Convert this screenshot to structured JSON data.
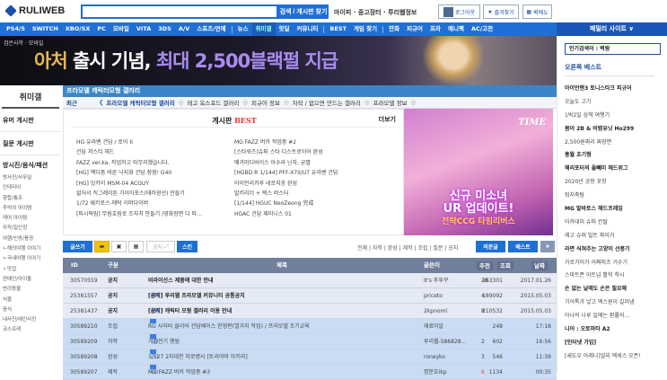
{
  "header": {
    "logo": "RULIWEB",
    "search_placeholder": "",
    "search_button": "검색 / 게시판 찾기",
    "links": "마이피 · 중고장터 · 루리웹정보",
    "logout": "로그아웃",
    "favorites": "즐겨찾기",
    "menu": "퀵메뉴"
  },
  "nav": {
    "items": [
      "PS4/5",
      "SWITCH",
      "XBO/SX",
      "PC",
      "모바일",
      "VITA",
      "3DS",
      "A/V",
      "스포츠/연예",
      "뉴스",
      "취미갤",
      "핫딜",
      "커뮤니티",
      "BEST",
      "게임 찾기",
      "만화",
      "피규어",
      "프라",
      "애니팩",
      "AC/고전"
    ],
    "active": "취미갤",
    "family": "패밀리 사이트 ∨"
  },
  "banner": {
    "brand": "검은사막 · 모바일",
    "headline_a": "아처",
    "headline_b": " 출시 기념, ",
    "headline_c": "최대 2,500블랙펄 지급"
  },
  "sidebar": {
    "title": "취미갤",
    "boards": [
      "유머 게시판",
      "질문 게시판"
    ],
    "category": "방시진/음식/패션",
    "items": [
      "방사진/사무실",
      "인테리어",
      "향합/통조",
      "추억의 아이템",
      "레어 아이템",
      "자작/일인칭",
      "여행/인증/풍경",
      "ㄴ해외여행 이야기",
      "ㄴ국내여행 이야기",
      "ㄴ맛집",
      "연예인/아이돌",
      "반려동물",
      "식물",
      "음식",
      "내사진/애인사진",
      "코스프레"
    ]
  },
  "gallery": {
    "title": "프라모델 캐릭터모형 갤러리",
    "recent": "최근",
    "tabs": [
      "프라모델 캐릭터모형 갤러리",
      "레고 옥스포드 갤러리",
      "피규어 정보",
      "자작 / 없으면 만드는 갤러리",
      "프라모델 정보"
    ]
  },
  "best": {
    "title": "게시판 ",
    "title_accent": "BEST",
    "more": "더보기",
    "left": [
      "HG 유라벤 건담 / 로어 II",
      "건담 저스티 헤드",
      "FAZZ ver.ka. 작업하고 마무리했습니다.",
      "[HG] 핵디즘 바른 낙지화 건담 참점! G40",
      "[HG] 잇카이 MSM-04 ACGUY",
      "없어서 직그레이튼 가이아포스(태러광선) 만들기",
      "1/72 쉐키로스-에탁 이머다이버",
      "[퍼시픽림] 무림호림로 조자치 만들기 /영화장면 다 따…"
    ],
    "right": [
      "MG FAZZ 버카 작업중 #2",
      "[스타워즈]슈퍼 스타 디스트로이어 완성",
      "메가미디바이스 아수라 닌자, 굳별",
      "[HGBD:R 1/144] PFF-X7II/U7 유라벤 건담",
      "아이언리카후 네로지옹 완성",
      "발키리더 + 렉스 버스터",
      "[1/144] HGUC NeoZeong 完成",
      "HGAC 건담 제미니스 01"
    ]
  },
  "ad": {
    "logo": "TIME",
    "line1": "신규 미소녀",
    "line2": "UR 업데이트!",
    "line3": "전략CCG 타임리버스"
  },
  "right_panel": {
    "popular": "인기검색어 : 벽람",
    "title": "오른쪽 베스트",
    "items": [
      {
        "t": "아이언맨3 토니스타크 피규어",
        "b": true
      },
      {
        "t": "오늘도 고기",
        "b": false
      },
      {
        "t": "1박2일 삼척 여행기",
        "b": false
      },
      {
        "t": "몸어 2B & 비렴유닛 Ho299",
        "b": true
      },
      {
        "t": "2,500원짜리 짜장면",
        "b": false
      },
      {
        "t": "홍월 초기형",
        "b": true
      },
      {
        "t": "해리포터의 올빼미 헤드위그",
        "b": true
      },
      {
        "t": "2020년 공항 포항",
        "b": false
      },
      {
        "t": "퇴지축탐",
        "b": false
      },
      {
        "t": "MG 발바토스 헤드프레임",
        "b": true
      },
      {
        "t": "아카데미 슈퍼 칸탈",
        "b": false
      },
      {
        "t": "레고 슈퍼 빌트 파이거",
        "b": false
      },
      {
        "t": "라면 식혀주는 고양이 선풍기",
        "b": true
      },
      {
        "t": "가로가이가 어쩌피츠 거수기",
        "b": false
      },
      {
        "t": "스마트폰 아트넘 활학 착시",
        "b": false
      },
      {
        "t": "손 없는 날에도 손은 필요해",
        "b": true
      },
      {
        "t": "기어톡가 낳고 엑스원이 길러냄",
        "b": false
      },
      {
        "t": "아나의 나루 일에는 환률의…",
        "b": false
      },
      {
        "t": "니어 : 오토마타 A2",
        "b": true
      },
      {
        "t": "[인터넷 가입]",
        "b": true
      },
      {
        "t": "[새도우 아레나]얼리 엑세스 오픈!",
        "b": false
      }
    ]
  },
  "toolbar": {
    "write": "글쓰기",
    "notice": "공지",
    "skin": "스킨",
    "filters": "전체 | 자작 | 완성 | 제작 | 조립 | 질문 | 공지",
    "recommend": "의문글",
    "best": "베스트"
  },
  "table": {
    "headers": [
      "ID",
      "구분",
      "제목",
      "글쓴이",
      "추천",
      "조회",
      "날짜"
    ],
    "rows": [
      {
        "id": "30570559",
        "cat": "공지",
        "title": "비라이선스 제품에 대한 안내",
        "cnt": "",
        "author": "It's 후루꾸",
        "rec": "20",
        "views": "163301",
        "date": "2017.01.26",
        "type": "n"
      },
      {
        "id": "25381557",
        "cat": "공지",
        "title": "[공지] 루리웹 프라모델 커뮤니티 공통공지",
        "cnt": "(7)",
        "author": "priceto",
        "rec": "4",
        "views": "189092",
        "date": "2015.05.03",
        "type": "n"
      },
      {
        "id": "25381437",
        "cat": "공지",
        "title": "[공지] 캐릭터 모형 갤러리 이용 안내",
        "cnt": "(3)",
        "author": "2kpnoml",
        "rec": "8",
        "views": "210532",
        "date": "2015.05.03",
        "type": "n"
      },
      {
        "id": "30589210",
        "cat": "조립",
        "title": "RG 사자비 클리어 건담베이스 한정판(열가지 작업) / 프라모델 조기교육",
        "cnt": "",
        "author": "재료이알",
        "rec": "",
        "views": "248",
        "date": "17:18",
        "type": "u"
      },
      {
        "id": "30589209",
        "cat": "자작",
        "title": "기갑전기 헨됨",
        "cnt": "(2)",
        "author": "루리웹-586828…",
        "rec": "2",
        "views": "602",
        "date": "16:56",
        "type": "u"
      },
      {
        "id": "30589208",
        "cat": "완성",
        "title": "1/127 2차대전 미로병사 [토리야마 아키라]",
        "cnt": "(3)",
        "author": "roneyko",
        "rec": "3",
        "views": "546",
        "date": "11:39",
        "type": "u"
      },
      {
        "id": "30589207",
        "cat": "제작",
        "title": "MG FAZZ 버카 작업중 #3",
        "cnt": "(1)",
        "author": "명문호ikp",
        "rec": "6",
        "views": "1134",
        "date": "00:35",
        "type": "u"
      }
    ]
  }
}
